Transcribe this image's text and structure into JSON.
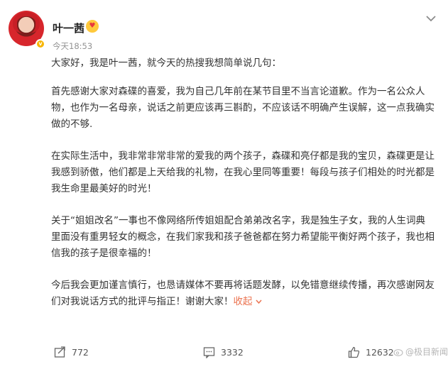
{
  "post": {
    "author_name": "叶一茜",
    "timestamp": "今天18:53",
    "paragraphs": [
      "大家好，我是叶一茜，就今天的热搜我想简单说几句：",
      "首先感谢大家对森碟的喜爱，我为自己几年前在某节目里不当言论道歉。作为一名公众人物，也作为一名母亲，说话之前更应该再三斟酌，不应该话不明确产生误解，这一点我确实做的不够.",
      "在实际生活中，我非常非常非常的爱我的两个孩子，森碟和亮仔都是我的宝贝，森碟更是让我感到骄傲，他们都是上天给我的礼物，在我心里同等重要！每段与孩子们相处的时光都是我生命里最美好的时光！",
      "关于“姐姐改名”一事也不像网络所传姐姐配合弟弟改名字，我是独生子女，我的人生词典里面没有重男轻女的概念，在我们家我和孩子爸爸都在努力希望能平衡好两个孩子，我也相信我的孩子是很幸福的！",
      "今后我会更加谨言慎行，也恳请媒体不要再将话题发酵，以免错意继续传播，再次感谢网友们对我说话方式的批评与指正！谢谢大家！"
    ],
    "collapse_label": "收起"
  },
  "actions": {
    "repost_count": "772",
    "comment_count": "3332",
    "like_count": "12632"
  },
  "watermark": "@极目新闻",
  "icons": {
    "menu": "chevron-down-icon",
    "repost": "repost-icon",
    "comment": "comment-icon",
    "like": "thumbs-up-icon",
    "verified": "verified-badge-icon"
  },
  "colors": {
    "accent": "#eb7350",
    "verified": "#f7b500",
    "muted": "#939393"
  }
}
